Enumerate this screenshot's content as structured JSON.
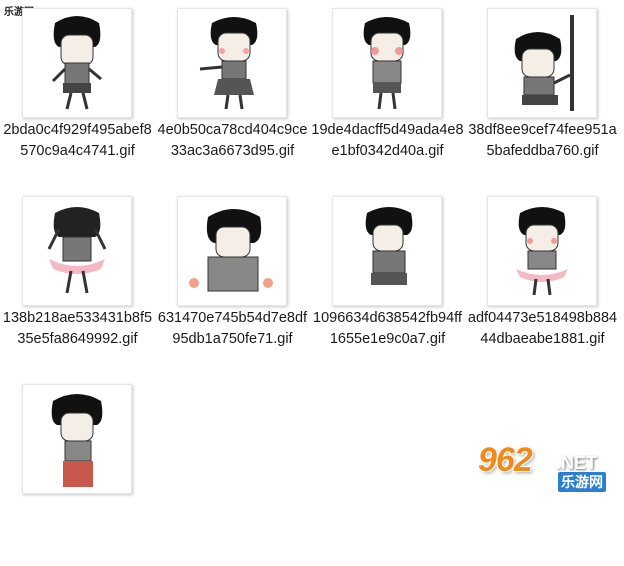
{
  "site_tag": "乐游网 www.962.net",
  "files": [
    {
      "name": "2bda0c4f929f495abef8570c9a4c4741.gif",
      "icon": "meme-character-standing-icon"
    },
    {
      "name": "4e0b50ca78cd404c9ce33ac3a6673d95.gif",
      "icon": "meme-character-pointing-icon"
    },
    {
      "name": "19de4dacff5d49ada4e8e1bf0342d40a.gif",
      "icon": "meme-character-blushing-icon"
    },
    {
      "name": "38df8ee9cef74fee951a5bafeddba760.gif",
      "icon": "meme-character-peeking-icon"
    },
    {
      "name": "138b218ae533431b8f535e5fa8649992.gif",
      "icon": "meme-character-ballerina-icon"
    },
    {
      "name": "631470e745b54d7e8df95db1a750fe71.gif",
      "icon": "meme-character-flowers-icon"
    },
    {
      "name": "1096634d638542fb94ff1655e1e9c0a7.gif",
      "icon": "meme-character-crouching-icon"
    },
    {
      "name": "adf04473e518498b88444dbaeabe1881.gif",
      "icon": "meme-character-tutu-icon"
    },
    {
      "name": "",
      "icon": "meme-character-red-pants-icon"
    }
  ],
  "watermark": {
    "number": "962",
    "tld": ".NET",
    "cn": "乐游网"
  },
  "colors": {
    "shadow": "#bdbdbd",
    "accent": "#f28a1b"
  }
}
